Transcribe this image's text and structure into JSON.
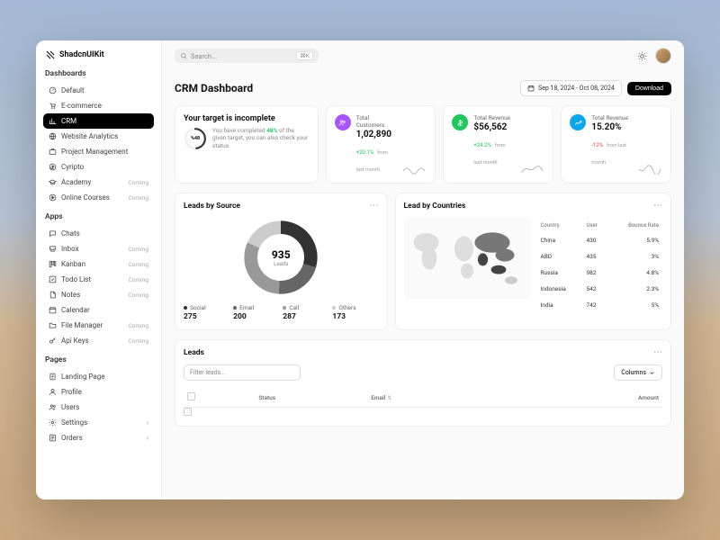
{
  "brand": "ShadcnUIKit",
  "search": {
    "placeholder": "Search...",
    "shortcut": "⌘K"
  },
  "sidebar": {
    "sections": [
      {
        "label": "Dashboards",
        "items": [
          {
            "icon": "gauge",
            "label": "Default"
          },
          {
            "icon": "cart",
            "label": "E-commerce"
          },
          {
            "icon": "chart",
            "label": "CRM",
            "active": true
          },
          {
            "icon": "globe",
            "label": "Website Analytics"
          },
          {
            "icon": "briefcase",
            "label": "Project Management"
          },
          {
            "icon": "coin",
            "label": "Cyripto"
          },
          {
            "icon": "cap",
            "label": "Academy",
            "badge": "Coming"
          },
          {
            "icon": "play",
            "label": "Online Courses",
            "badge": "Coming"
          }
        ]
      },
      {
        "label": "Apps",
        "items": [
          {
            "icon": "chat",
            "label": "Chats"
          },
          {
            "icon": "inbox",
            "label": "Inbox",
            "badge": "Coming"
          },
          {
            "icon": "kanban",
            "label": "Kanban",
            "badge": "Coming"
          },
          {
            "icon": "check",
            "label": "Todo List",
            "badge": "Coming"
          },
          {
            "icon": "note",
            "label": "Notes",
            "badge": "Coming"
          },
          {
            "icon": "calendar",
            "label": "Calendar"
          },
          {
            "icon": "folder",
            "label": "File Manager",
            "badge": "Coming"
          },
          {
            "icon": "key",
            "label": "Api Keys",
            "badge": "Coming"
          }
        ]
      },
      {
        "label": "Pages",
        "items": [
          {
            "icon": "page",
            "label": "Landing Page"
          },
          {
            "icon": "user",
            "label": "Profile"
          },
          {
            "icon": "users",
            "label": "Users"
          },
          {
            "icon": "gear",
            "label": "Settings",
            "chevron": true
          },
          {
            "icon": "orders",
            "label": "Orders",
            "chevron": true
          }
        ]
      }
    ]
  },
  "page": {
    "title": "CRM Dashboard",
    "dateRange": "Sep 18, 2024 - Oct 08, 2024",
    "download": "Download"
  },
  "target": {
    "title": "Your target is incomplete",
    "ringPct": "48",
    "desc1": "You have completed ",
    "descPct": "48%",
    "desc2": " of the given target, you can also check your status"
  },
  "stats": [
    {
      "icon": "purple",
      "label": "Total Customers",
      "value": "1,02,890",
      "delta": "+20.1%",
      "dir": "up",
      "sub": "from last month"
    },
    {
      "icon": "green",
      "label": "Total Revenue",
      "value": "$56,562",
      "delta": "+24.2%",
      "dir": "up",
      "sub": "from last month"
    },
    {
      "icon": "blue",
      "label": "Total Revenue",
      "value": "15.20%",
      "delta": "-12%",
      "dir": "down",
      "sub": "from last month"
    }
  ],
  "leadsBySource": {
    "title": "Leads by Source",
    "total": "935",
    "totalLabel": "Leads",
    "legend": [
      {
        "name": "Social",
        "val": "275",
        "color": "#333"
      },
      {
        "name": "Email",
        "val": "200",
        "color": "#666"
      },
      {
        "name": "Call",
        "val": "287",
        "color": "#999"
      },
      {
        "name": "Others",
        "val": "173",
        "color": "#ccc"
      }
    ]
  },
  "leadByCountries": {
    "title": "Lead by Countries",
    "headers": [
      "Country",
      "User",
      "Bounce Rate"
    ],
    "rows": [
      {
        "c": "China",
        "u": "430",
        "b": "5.9%"
      },
      {
        "c": "ABD",
        "u": "435",
        "b": "3%"
      },
      {
        "c": "Russia",
        "u": "982",
        "b": "4.8%"
      },
      {
        "c": "Indonesia",
        "u": "542",
        "b": "2.3%"
      },
      {
        "c": "India",
        "u": "742",
        "b": "5%"
      }
    ]
  },
  "leads": {
    "title": "Leads",
    "filterPlaceholder": "Filter leads...",
    "columnsBtn": "Columns",
    "headers": [
      "",
      "Status",
      "Email",
      "",
      "Amount"
    ]
  },
  "chart_data": [
    {
      "type": "pie",
      "title": "Leads by Source",
      "categories": [
        "Social",
        "Email",
        "Call",
        "Others"
      ],
      "values": [
        275,
        200,
        287,
        173
      ],
      "total": 935
    },
    {
      "type": "table",
      "title": "Lead by Countries",
      "columns": [
        "Country",
        "User",
        "Bounce Rate"
      ],
      "rows": [
        [
          "China",
          430,
          5.9
        ],
        [
          "ABD",
          435,
          3.0
        ],
        [
          "Russia",
          982,
          4.8
        ],
        [
          "Indonesia",
          542,
          2.3
        ],
        [
          "India",
          742,
          5.0
        ]
      ]
    }
  ]
}
